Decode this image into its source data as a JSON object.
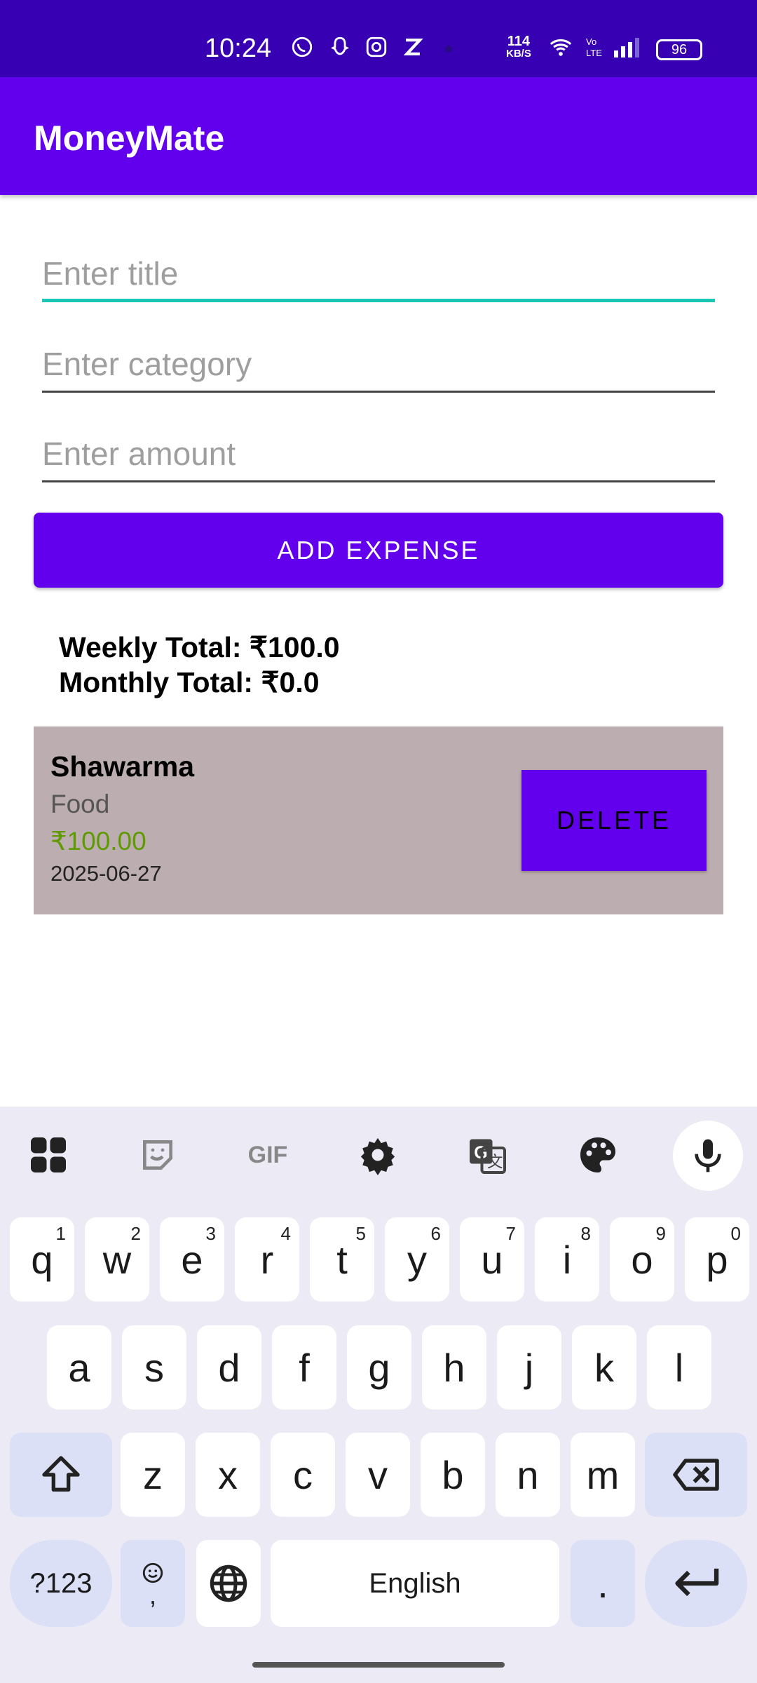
{
  "status_bar": {
    "time": "10:24",
    "net_speed_value": "114",
    "net_speed_unit": "KB/S",
    "battery": "96",
    "icons": [
      "whatsapp-icon",
      "snapchat-icon",
      "instagram-icon",
      "zepto-icon",
      "dot-icon",
      "wifi-icon",
      "volte-icon",
      "signal-icon",
      "battery-icon"
    ]
  },
  "app_bar": {
    "title": "MoneyMate",
    "color": "#6200EE"
  },
  "form": {
    "title_placeholder": "Enter title",
    "category_placeholder": "Enter category",
    "amount_placeholder": "Enter amount",
    "add_button": "ADD EXPENSE"
  },
  "totals": {
    "weekly": "Weekly Total: ₹100.0",
    "monthly": "Monthly Total: ₹0.0"
  },
  "expenses": [
    {
      "title": "Shawarma",
      "category": "Food",
      "amount": "₹100.00",
      "date": "2025-06-27",
      "delete_label": "DELETE"
    }
  ],
  "keyboard": {
    "toolbar": [
      "apps-grid-icon",
      "sticker-icon",
      "gif-icon",
      "settings-gear-icon",
      "translate-icon",
      "palette-icon",
      "microphone-icon"
    ],
    "gif_label": "GIF",
    "row1": [
      {
        "k": "q",
        "n": "1"
      },
      {
        "k": "w",
        "n": "2"
      },
      {
        "k": "e",
        "n": "3"
      },
      {
        "k": "r",
        "n": "4"
      },
      {
        "k": "t",
        "n": "5"
      },
      {
        "k": "y",
        "n": "6"
      },
      {
        "k": "u",
        "n": "7"
      },
      {
        "k": "i",
        "n": "8"
      },
      {
        "k": "o",
        "n": "9"
      },
      {
        "k": "p",
        "n": "0"
      }
    ],
    "row2": [
      "a",
      "s",
      "d",
      "f",
      "g",
      "h",
      "j",
      "k",
      "l"
    ],
    "row3": [
      "z",
      "x",
      "c",
      "v",
      "b",
      "n",
      "m"
    ],
    "symbols_key": "?123",
    "emoji_comma_key": ",",
    "space_label": "English",
    "period_key": "."
  }
}
